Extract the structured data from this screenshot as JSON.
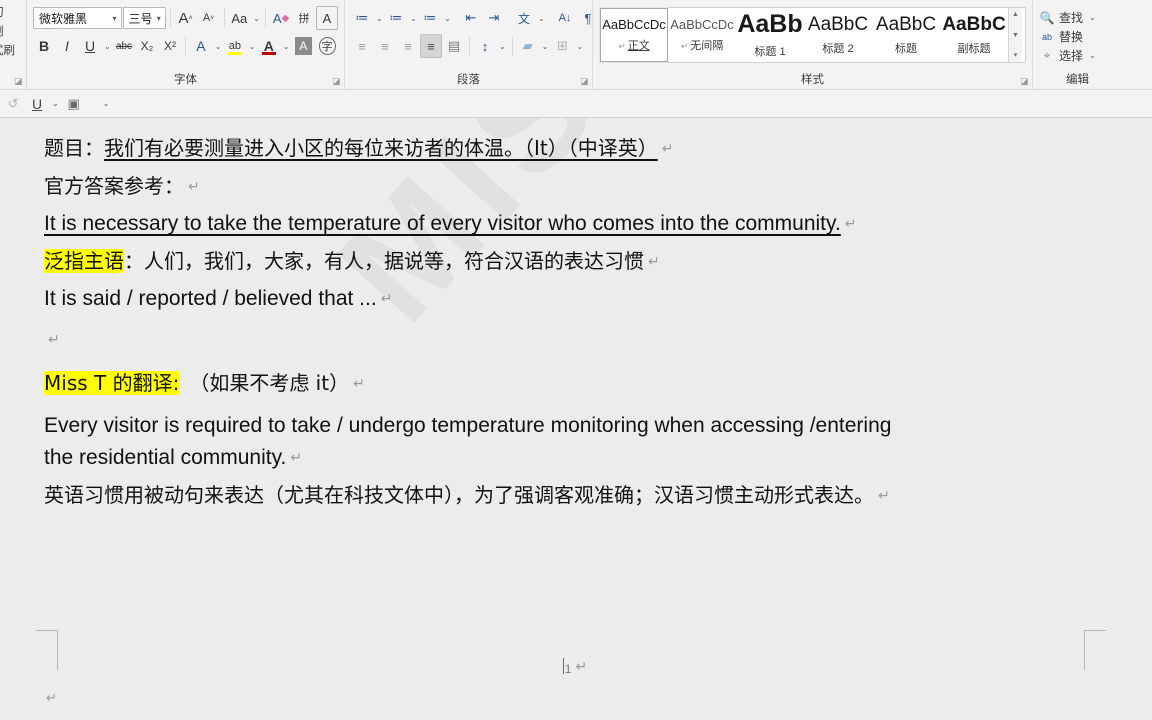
{
  "ribbon": {
    "clipboard_group": {
      "clipped_labels": [
        "切",
        "制",
        "式刷"
      ]
    },
    "font_group": {
      "label": "字体",
      "font_name": "微软雅黑",
      "font_size": "三号",
      "grow_font": "A",
      "shrink_font": "A",
      "change_case": "Aa",
      "clear_formatting": "A",
      "phonetic_guide": "拼",
      "char_border": "A",
      "bold": "B",
      "italic": "I",
      "underline": "U",
      "strikethrough": "abc",
      "subscript": "X₂",
      "superscript": "X²",
      "text_effects": "A",
      "highlight_color": "ab",
      "font_color": "A",
      "char_shading": "A",
      "enclose_char": "字",
      "highlight_hex": "#ffff00",
      "font_color_hex": "#c00000"
    },
    "paragraph_group": {
      "label": "段落",
      "bullets": "≔",
      "numbering": "≔",
      "multilevel_list": "≔",
      "decrease_indent": "⇤",
      "increase_indent": "⇥",
      "asian_layout": "文",
      "sort": "A↓",
      "show_marks": "¶",
      "align_left": "≡",
      "align_center": "≡",
      "align_right": "≡",
      "justify": "≡",
      "distributed": "▤",
      "line_spacing": "↕",
      "shading": "▰",
      "borders": "⊞",
      "active_button": "justify"
    },
    "styles_group": {
      "label": "样式",
      "items": [
        {
          "preview": "AaBbCcDc",
          "name": "正文",
          "pilcrow": "↵",
          "selected": true,
          "size": 13,
          "weight": "normal",
          "underline": true
        },
        {
          "preview": "AaBbCcDc",
          "name": "无间隔",
          "pilcrow": "↵",
          "selected": false,
          "size": 13,
          "weight": "normal",
          "underline": false
        },
        {
          "preview": "AaBb",
          "name": "标题 1",
          "pilcrow": "",
          "selected": false,
          "size": 25,
          "weight": "bold",
          "underline": false
        },
        {
          "preview": "AaBbC",
          "name": "标题 2",
          "pilcrow": "",
          "selected": false,
          "size": 19,
          "weight": "normal",
          "underline": false
        },
        {
          "preview": "AaBbC",
          "name": "标题",
          "pilcrow": "",
          "selected": false,
          "size": 19,
          "weight": "normal",
          "underline": false
        },
        {
          "preview": "AaBbC",
          "name": "副标题",
          "pilcrow": "",
          "selected": false,
          "size": 19,
          "weight": "bold",
          "underline": false
        }
      ],
      "scroll_up": "▲",
      "scroll_down": "▼",
      "more": "▾"
    },
    "editing_group": {
      "label": "编辑",
      "find": "查找",
      "replace": "替换",
      "select": "选择",
      "find_icon": "search-icon",
      "replace_icon": "ab-replace-icon",
      "select_icon": "cursor-icon"
    }
  },
  "subbar": {
    "undo": "↺",
    "underline": "U",
    "underline_arrow": "⌄",
    "screenshot": "▣",
    "more_arrow": "⌄"
  },
  "document": {
    "watermark": "MISS T",
    "lines": [
      {
        "id": "title-line",
        "lang": "cn",
        "segments": [
          {
            "text": "题目：",
            "underline": false,
            "highlight": false
          },
          {
            "text": "我们有必要测量进入小区的每位来访者的体温。（It）（中译英）",
            "underline": true,
            "highlight": false
          }
        ],
        "pilcrow": "↵"
      },
      {
        "id": "official-answer-label",
        "lang": "cn",
        "segments": [
          {
            "text": "官方答案参考：",
            "underline": false,
            "highlight": false
          }
        ],
        "pilcrow": "↵"
      },
      {
        "id": "official-answer-text",
        "lang": "en",
        "segments": [
          {
            "text": "It is necessary to take the temperature of every visitor who comes into the community.",
            "underline": true,
            "highlight": false
          }
        ],
        "pilcrow": "↵"
      },
      {
        "id": "generic-subject-line",
        "lang": "cn",
        "segments": [
          {
            "text": "泛指主语",
            "underline": false,
            "highlight": true
          },
          {
            "text": "：人们，我们，大家，有人，据说等，符合汉语的表达习惯",
            "underline": false,
            "highlight": false
          }
        ],
        "pilcrow": "↵"
      },
      {
        "id": "it-is-said-line",
        "lang": "en",
        "segments": [
          {
            "text": "It is said / reported / believed that ...",
            "underline": false,
            "highlight": false
          }
        ],
        "pilcrow": "↵"
      },
      {
        "id": "empty-line",
        "lang": "cn",
        "segments": [],
        "pilcrow": "↵"
      },
      {
        "id": "miss-t-label-line",
        "lang": "cn",
        "segments": [
          {
            "text": "Miss T 的翻译:",
            "underline": false,
            "highlight": true
          },
          {
            "text": "　（如果不考虑 it）",
            "underline": false,
            "highlight": false
          }
        ],
        "pilcrow": "↵"
      }
    ],
    "miss_t_translation": {
      "id": "miss-t-translation",
      "line1": "Every visitor is required to take / undergo temperature monitoring when accessing /entering",
      "line2": "the residential community.",
      "pilcrow": "↵"
    },
    "final_note": {
      "id": "final-note-line",
      "text": "英语习惯用被动句来表达（尤其在科技文体中），为了强调客观准确；汉语习惯主动形式表达。",
      "pilcrow": "↵"
    },
    "footer": {
      "page_number": "1",
      "page_number_pilcrow": "↵",
      "trailing_pilcrow": "↵"
    }
  }
}
